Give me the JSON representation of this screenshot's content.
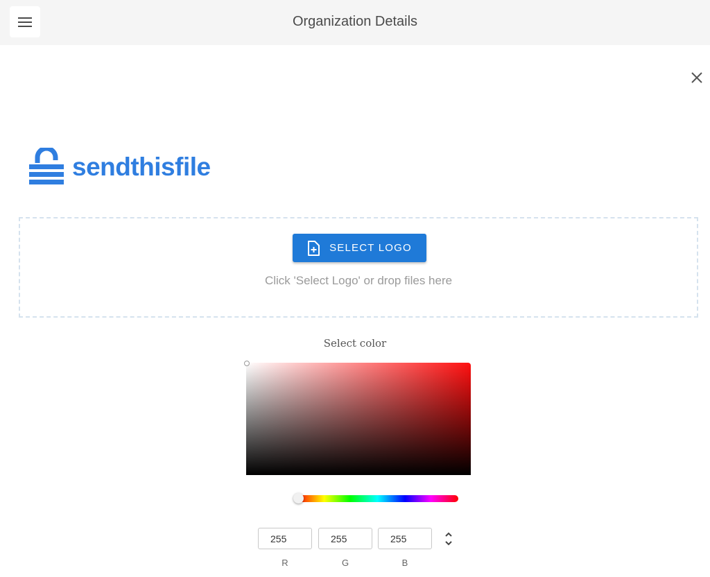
{
  "header": {
    "title": "Organization Details",
    "menu_icon": "hamburger-menu-icon"
  },
  "dialog": {
    "close_icon": "close-icon"
  },
  "logo": {
    "text": "sendthisfile",
    "icon": "padlock-logo-icon",
    "color": "#2f7ee0"
  },
  "upload": {
    "button_label": "SELECT LOGO",
    "button_icon": "file-plus-icon",
    "hint": "Click 'Select Logo' or drop files here",
    "button_color": "#1f7ad8"
  },
  "color_picker": {
    "label": "Select color",
    "hue_color": "#ff1010",
    "r_value": "255",
    "g_value": "255",
    "b_value": "255",
    "r_label": "R",
    "g_label": "G",
    "b_label": "B",
    "mode_toggle_icon": "chevron-up-down-icon"
  }
}
